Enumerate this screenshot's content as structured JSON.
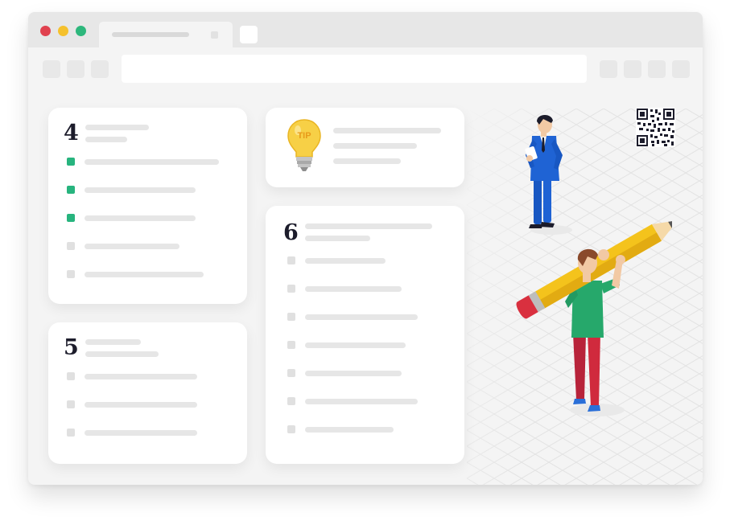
{
  "window": {
    "traffic_lights": {
      "close": "#e0414f",
      "minimize": "#f5c12d",
      "maximize": "#2db77c"
    },
    "icons": {
      "new_tab": "plus-icon",
      "tab_close": "close-icon"
    }
  },
  "illustration": {
    "tip_label": "TIP",
    "qr": "qr-code-icon",
    "colors": {
      "jacket": "#1f63d4",
      "shirt": "#26a86b",
      "trousers": "#d02a3d",
      "pencil": "#f4c31c",
      "bulb": "#f7d046"
    }
  },
  "cards": {
    "card4": {
      "number": "4",
      "items": [
        {
          "checked": true
        },
        {
          "checked": true
        },
        {
          "checked": true
        },
        {
          "checked": false
        },
        {
          "checked": false
        }
      ]
    },
    "card5": {
      "number": "5",
      "items": [
        {
          "checked": false
        },
        {
          "checked": false
        },
        {
          "checked": false
        }
      ]
    },
    "card6": {
      "number": "6",
      "items": [
        {
          "checked": false
        },
        {
          "checked": false
        },
        {
          "checked": false
        },
        {
          "checked": false
        },
        {
          "checked": false
        },
        {
          "checked": false
        },
        {
          "checked": false
        }
      ]
    }
  }
}
